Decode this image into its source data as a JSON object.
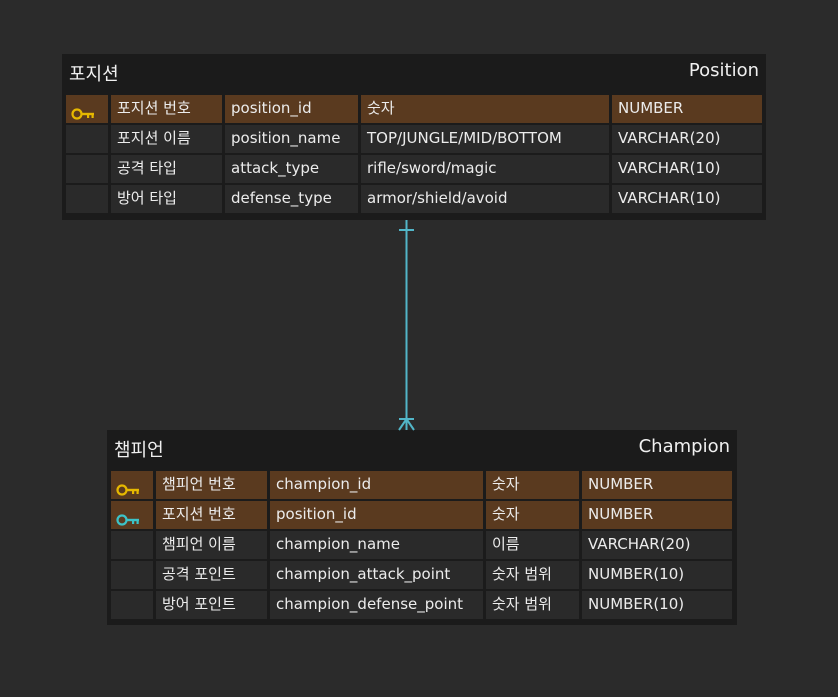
{
  "colors": {
    "background": "#2b2b2b",
    "entity_bg": "#1b1b1b",
    "cell_bg": "#2a2a2a",
    "pk_row_bg": "#5a3a1f",
    "pk_key": "#e6b800",
    "fk_key": "#3cc3c8",
    "relation_line": "#52b6c8"
  },
  "position_entity": {
    "name_kr": "포지션",
    "name_en": "Position",
    "rows": [
      {
        "key": "pk",
        "logical": "포지션 번호",
        "physical": "position_id",
        "domain": "숫자",
        "type": "NUMBER"
      },
      {
        "key": "",
        "logical": "포지션 이름",
        "physical": "position_name",
        "domain": "TOP/JUNGLE/MID/BOTTOM",
        "type": "VARCHAR(20)"
      },
      {
        "key": "",
        "logical": "공격 타입",
        "physical": "attack_type",
        "domain": "rifle/sword/magic",
        "type": "VARCHAR(10)"
      },
      {
        "key": "",
        "logical": "방어 타입",
        "physical": "defense_type",
        "domain": "armor/shield/avoid",
        "type": "VARCHAR(10)"
      }
    ]
  },
  "champion_entity": {
    "name_kr": "챔피언",
    "name_en": "Champion",
    "rows": [
      {
        "key": "pk",
        "logical": "챔피언 번호",
        "physical": "champion_id",
        "domain": "숫자",
        "type": "NUMBER"
      },
      {
        "key": "fk",
        "logical": "포지션 번호",
        "physical": "position_id",
        "domain": "숫자",
        "type": "NUMBER"
      },
      {
        "key": "",
        "logical": "챔피언 이름",
        "physical": "champion_name",
        "domain": "이름",
        "type": "VARCHAR(20)"
      },
      {
        "key": "",
        "logical": "공격 포인트",
        "physical": "champion_attack_point",
        "domain": "숫자 범위",
        "type": "NUMBER(10)"
      },
      {
        "key": "",
        "logical": "방어 포인트",
        "physical": "champion_defense_point",
        "domain": "숫자 범위",
        "type": "NUMBER(10)"
      }
    ]
  },
  "relationship": {
    "type": "one-to-many"
  }
}
